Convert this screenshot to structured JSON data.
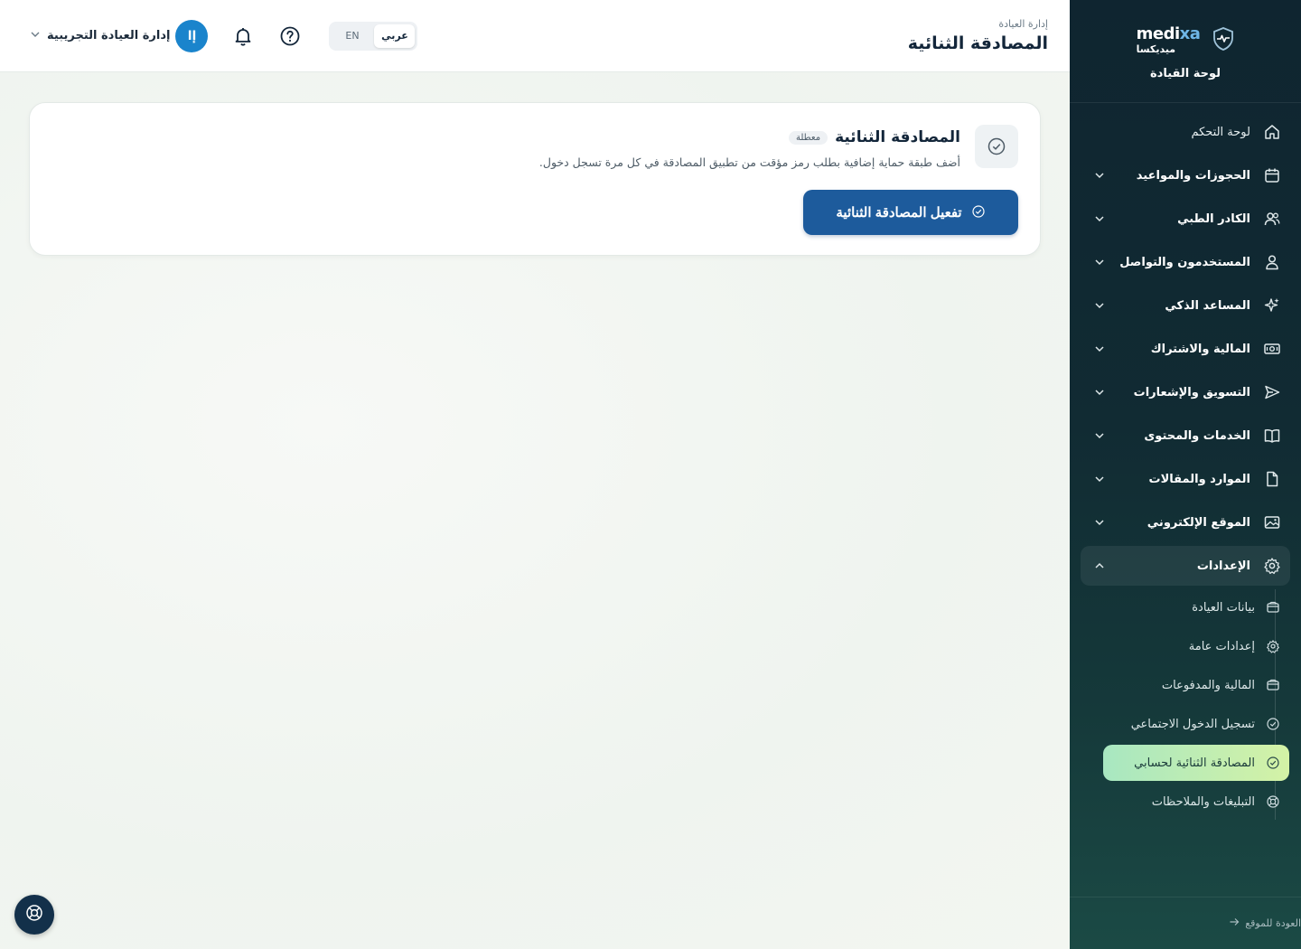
{
  "brand": {
    "name_en_a": "medi",
    "name_en_b": "xa",
    "name_ar": "ميديكسا",
    "section": "لوحة القيادة"
  },
  "sidebar": {
    "items": [
      {
        "label": "لوحة التحكم",
        "icon": "home-icon",
        "expandable": false
      },
      {
        "label": "الحجوزات والمواعيد",
        "icon": "calendar-icon",
        "expandable": true
      },
      {
        "label": "الكادر الطبي",
        "icon": "users-icon",
        "expandable": true
      },
      {
        "label": "المستخدمون والتواصل",
        "icon": "user-icon",
        "expandable": true
      },
      {
        "label": "المساعد الذكي",
        "icon": "sparkles-icon",
        "expandable": true
      },
      {
        "label": "المالية والاشتراك",
        "icon": "cash-icon",
        "expandable": true
      },
      {
        "label": "التسويق والإشعارات",
        "icon": "send-icon",
        "expandable": true
      },
      {
        "label": "الخدمات والمحتوى",
        "icon": "book-icon",
        "expandable": true
      },
      {
        "label": "الموارد والمقالات",
        "icon": "file-icon",
        "expandable": true
      },
      {
        "label": "الموقع الإلكتروني",
        "icon": "image-icon",
        "expandable": true
      },
      {
        "label": "الإعدادات",
        "icon": "gear-icon",
        "expandable": true,
        "open": true
      }
    ],
    "settings_sub": [
      {
        "label": "بيانات العيادة",
        "icon": "wallet-icon"
      },
      {
        "label": "إعدادات عامة",
        "icon": "cog-icon"
      },
      {
        "label": "المالية والمدفوعات",
        "icon": "wallet-icon"
      },
      {
        "label": "تسجيل الدخول الاجتماعي",
        "icon": "check-circle-icon"
      },
      {
        "label": "المصادقة الثنائية لحسابي",
        "icon": "check-circle-icon",
        "active": true
      },
      {
        "label": "التبليغات والملاحظات",
        "icon": "lifebuoy-icon"
      }
    ],
    "back_label": "العودة للموقع"
  },
  "header": {
    "breadcrumb": "إدارة العيادة",
    "title": "المصادقة الثنائية",
    "lang_ar": "عربي",
    "lang_en": "EN",
    "avatar_initials": "إا",
    "user_name": "إدارة العيادة التجريبية"
  },
  "card": {
    "title": "المصادقة الثنائية",
    "badge": "معطلة",
    "description": "أضف طبقة حماية إضافية بطلب رمز مؤقت من تطبيق المصادقة في كل مرة تسجل دخول.",
    "cta_label": "تفعيل المصادقة الثنائية"
  },
  "colors": {
    "accent": "#1d5b9c",
    "sidebar_bg": "#112b33",
    "active_sub": "#b9ecb6",
    "avatar": "#1a84cc"
  }
}
